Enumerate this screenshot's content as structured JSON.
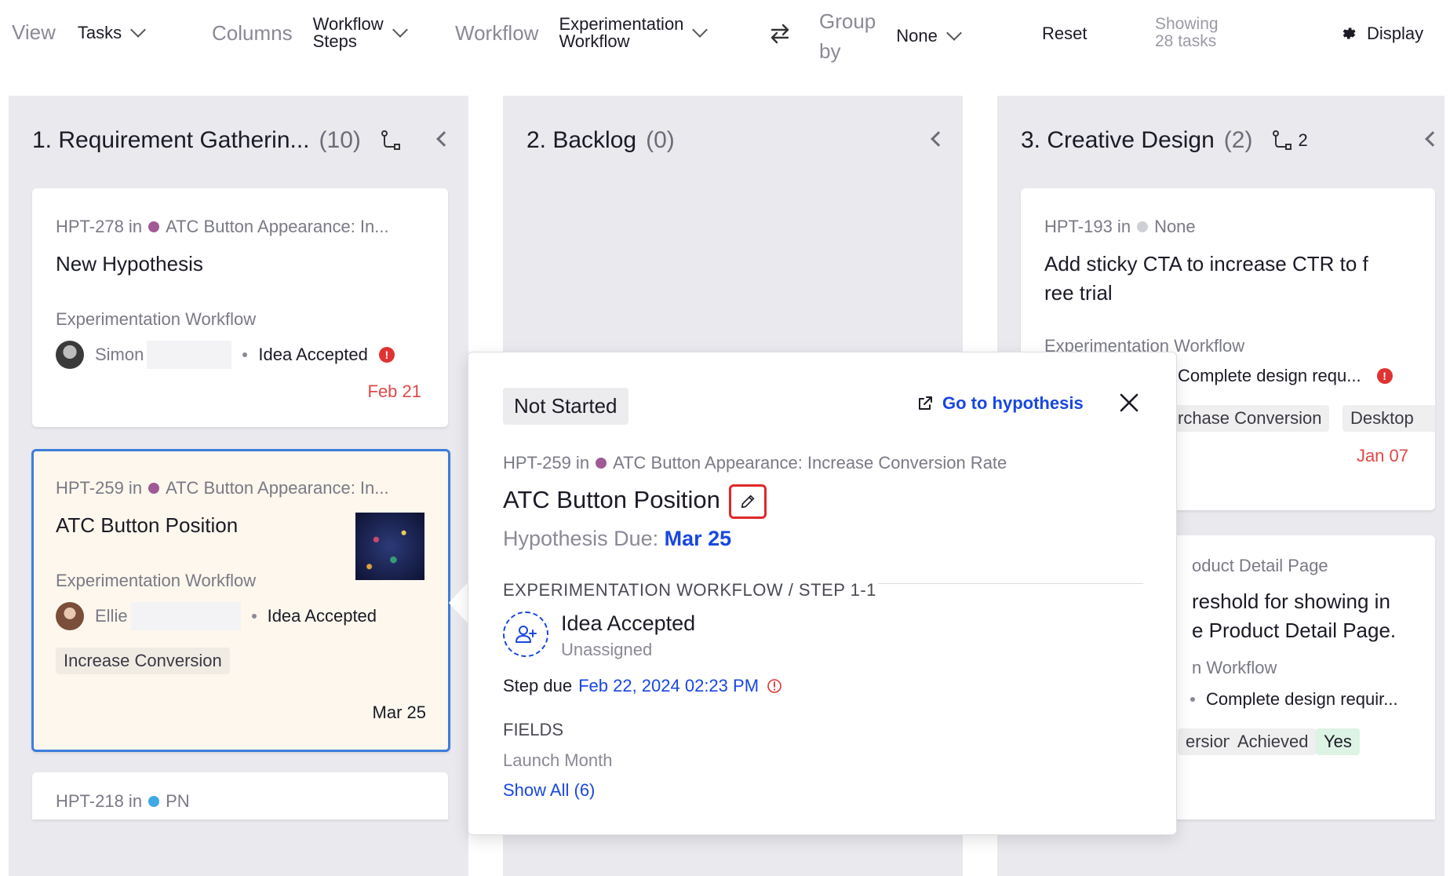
{
  "toolbar": {
    "view_label": "View",
    "view_value": "Tasks",
    "columns_label": "Columns",
    "columns_value_line1": "Workflow",
    "columns_value_line2": "Steps",
    "workflow_label": "Workflow",
    "workflow_value_line1": "Experimentation",
    "workflow_value_line2": "Workflow",
    "groupby_label_line1": "Group",
    "groupby_label_line2": "by",
    "groupby_value": "None",
    "reset_label": "Reset",
    "showing_line1": "Showing",
    "showing_line2": "28 tasks",
    "display_label": "Display"
  },
  "columns": [
    {
      "title": "1. Requirement Gatherin...",
      "count": "(10)",
      "cards": [
        {
          "meta_prefix": "HPT-278 in",
          "meta_project": "ATC Button Appearance: In...",
          "dot_color": "#a05a96",
          "title": "New Hypothesis",
          "workflow": "Experimentation Workflow",
          "assignee": "Simon",
          "step": "Idea Accepted",
          "date": "Feb 21",
          "date_color": "#e04848"
        },
        {
          "meta_prefix": "HPT-259 in",
          "meta_project": "ATC Button Appearance: In...",
          "dot_color": "#a05a96",
          "title": "ATC Button Position",
          "workflow": "Experimentation Workflow",
          "assignee": "Ellie",
          "step": "Idea Accepted",
          "tag": "Increase Conversion",
          "date": "Mar 25"
        },
        {
          "meta_prefix": "HPT-218 in",
          "meta_project": "PN",
          "dot_color": "#3fa8e6"
        }
      ]
    },
    {
      "title": "2. Backlog",
      "count": "(0)"
    },
    {
      "title": "3. Creative Design",
      "count": "(2)",
      "sub_count": "2",
      "cards": [
        {
          "meta_prefix": "HPT-193 in",
          "meta_project": "None",
          "dot_color": "#cfcfd6",
          "title_line1": "Add sticky CTA to increase CTR to f",
          "title_line2": "ree trial",
          "workflow": "Experimentation Workflow",
          "step": "Complete design requ...",
          "tag1": "rchase Conversion",
          "tag2": "Desktop",
          "date": "Jan 07",
          "date_color": "#e04848"
        },
        {
          "meta": "oduct Detail Page",
          "title_line1": "reshold for showing in",
          "title_line2": "e Product Detail Page.",
          "workflow": "n Workflow",
          "step": "Complete design requir...",
          "tag1": "ersion",
          "tag2": "Achieved",
          "tag3": "Yes"
        }
      ]
    }
  ],
  "popover": {
    "status": "Not Started",
    "goto_label": "Go to hypothesis",
    "meta_prefix": "HPT-259 in",
    "meta_project": "ATC Button Appearance: Increase Conversion Rate",
    "title": "ATC Button Position",
    "due_label": "Hypothesis Due:",
    "due_value": "Mar 25",
    "section": "EXPERIMENTATION WORKFLOW / STEP 1-1",
    "step_name": "Idea Accepted",
    "step_assignee": "Unassigned",
    "step_due_label": "Step due",
    "step_due_value": "Feb 22, 2024 02:23 PM",
    "fields_heading": "FIELDS",
    "field_label": "Launch Month",
    "show_all": "Show All (6)"
  },
  "colors": {
    "accent_blue": "#1847e0",
    "alert_red": "#e03232",
    "selected_border": "#3d7ddb"
  }
}
